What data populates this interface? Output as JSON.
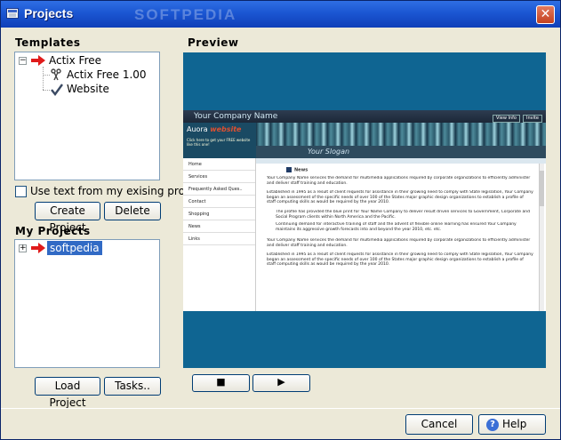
{
  "window": {
    "title": "Projects",
    "watermark": "SOFTPEDIA"
  },
  "templates": {
    "label": "Templates",
    "tree": [
      {
        "label": "Actix Free",
        "icon": "red-arrow-icon"
      },
      {
        "label": "Actix Free 1.00",
        "icon": "scissors-icon"
      },
      {
        "label": "Website",
        "icon": "checkmark-icon"
      }
    ],
    "use_existing_label": "Use text from my exising project",
    "create_label": "Create Project",
    "delete_label": "Delete"
  },
  "my_projects": {
    "label": "My Projects",
    "tree": [
      {
        "label": "softpedia",
        "icon": "red-arrow-icon"
      }
    ],
    "load_label": "Load Project",
    "tasks_label": "Tasks.."
  },
  "preview": {
    "label": "Preview",
    "site": {
      "company": "Your Company Name",
      "header_links": [
        "View Info",
        "Invite"
      ],
      "brand": "Auora",
      "brand_accent": "website",
      "brand_sub": "Click here to get your FREE website like this one!",
      "slogan": "Your Slogan",
      "nav": [
        "Home",
        "Services",
        "Frequently Asked Ques..",
        "Contact",
        "Shopping",
        "News",
        "Links"
      ],
      "news_tag": "News",
      "paragraphs": [
        "Your Company Name services the demand for multimedia applications required by corporate organizations to efficiently administer and deliver staff training and education.",
        "Established in 1995 as a result of client requests for assistance in their growing need to comply with State legislation, Your Company began an assessment of the specific needs of over 100 of the States major graphic design organizations to establish a profile of staff computing skills as would be required by the year 2010.",
        "The profile has provided the blue print for Your Name Company to deliver result driven services to Government, Corporate and Social Program clients within North America and the Pacific.",
        "Continuing demand for interactive training of staff and the advent of flexible online learning has ensured Your Company maintains its aggressive growth forecasts into and beyond the year 2010, etc. etc.",
        "Your Company Name services the demand for multimedia applications required by corporate organizations to efficiently administer and deliver staff training and education.",
        "Established in 1995 as a result of client requests for assistance in their growing need to comply with State legislation, Your Company began an assessment of the specific needs of over 100 of the States major graphic design organizations to establish a profile of staff computing skills as would be required by the year 2010."
      ]
    },
    "stop_symbol": "■",
    "play_symbol": "▶"
  },
  "footer": {
    "cancel_label": "Cancel",
    "help_label": "Help"
  }
}
